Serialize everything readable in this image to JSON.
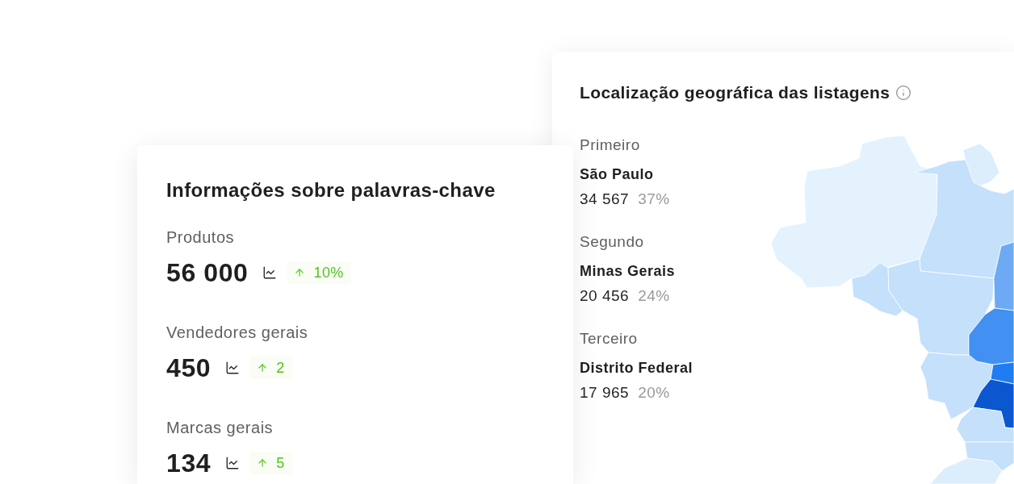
{
  "keyword_card": {
    "title": "Informações sobre palavras-chave",
    "metrics": [
      {
        "label": "Produtos",
        "value": "56 000",
        "rising": true,
        "change": "10%"
      },
      {
        "label": "Vendedores gerais",
        "value": "450",
        "rising": true,
        "change": "2"
      },
      {
        "label": "Marcas gerais",
        "value": "134",
        "rising": true,
        "change": "5"
      }
    ]
  },
  "location_card": {
    "title": "Localização geográfica das listagens",
    "rankings": [
      {
        "rank": "Primeiro",
        "region": "São Paulo",
        "count": "34 567",
        "share": "37%"
      },
      {
        "rank": "Segundo",
        "region": "Minas Gerais",
        "count": "20 456",
        "share": "24%"
      },
      {
        "rank": "Terceiro",
        "region": "Distrito Federal",
        "count": "17 965",
        "share": "20%"
      }
    ],
    "map": {
      "regions": [
        {
          "color": "#e4f2fd"
        },
        {
          "color": "#dcedfc"
        },
        {
          "color": "#c4e0fa"
        },
        {
          "color": "#c4e0fa"
        },
        {
          "color": "#c4e0fa"
        },
        {
          "color": "#c4e0fa"
        },
        {
          "color": "#6daaf3"
        },
        {
          "color": "#4190f2"
        },
        {
          "color": "#1f7cf2"
        },
        {
          "color": "#0b57d0"
        },
        {
          "color": "#c4e0fa"
        },
        {
          "color": "#c4e0fa"
        },
        {
          "color": "#dcedfc"
        }
      ]
    }
  }
}
